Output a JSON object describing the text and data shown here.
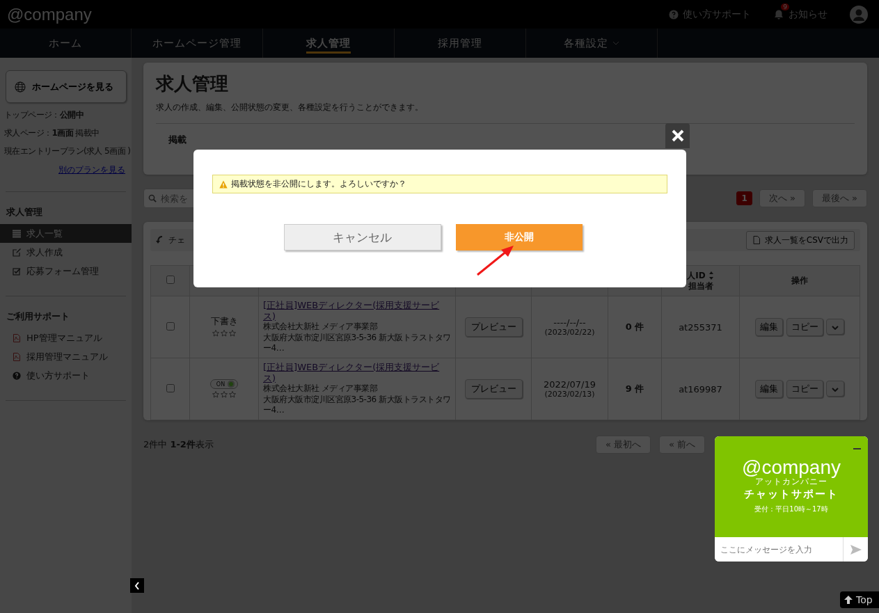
{
  "header": {
    "logo": "@company",
    "help": "使い方サポート",
    "notifications": {
      "label": "お知らせ",
      "badge": "9"
    }
  },
  "nav": [
    {
      "label": "ホーム",
      "selected": false,
      "dropdown": false
    },
    {
      "label": "ホームページ管理",
      "selected": false,
      "dropdown": false
    },
    {
      "label": "求人管理",
      "selected": true,
      "dropdown": false
    },
    {
      "label": "採用管理",
      "selected": false,
      "dropdown": false
    },
    {
      "label": "各種設定",
      "selected": false,
      "dropdown": true
    }
  ],
  "sidebar": {
    "view_site_button": "ホームページを見る",
    "status_lines": [
      "トップページ：**公開中**",
      "求人ページ：**1画面** 掲載中",
      "現在エントリープラン(求人 5画面 )"
    ],
    "plan_link": "別のプランを見る",
    "sections": [
      {
        "title": "求人管理",
        "items": [
          {
            "label": "求人一覧",
            "kind": "list",
            "selected": true
          },
          {
            "label": "求人作成",
            "kind": "edit",
            "selected": false
          },
          {
            "label": "応募フォーム管理",
            "kind": "check",
            "selected": false
          }
        ]
      },
      {
        "title": "ご利用サポート",
        "items": [
          {
            "label": "HP管理マニュアル",
            "kind": "pdf",
            "selected": false
          },
          {
            "label": "採用管理マニュアル",
            "kind": "pdf",
            "selected": false
          },
          {
            "label": "使い方サポート",
            "kind": "help",
            "selected": false
          }
        ]
      }
    ]
  },
  "page": {
    "title": "求人管理",
    "description": "求人の作成、編集、公開状態の変更、各種設定を行うことができます。",
    "status_label": "掲載"
  },
  "search": {
    "placeholder": "検索を"
  },
  "pagination_top": {
    "pages": [
      {
        "label": "1",
        "selected": true
      }
    ],
    "next": "次へ »",
    "last": "最後へ »"
  },
  "toolbar": {
    "check_label": "チェ",
    "csv_button": "求人一覧をCSVで出力"
  },
  "table": {
    "columns": {
      "id": "人ID",
      "id_sub": "担当者",
      "actions": "操作"
    },
    "header_checked": false,
    "rows": [
      {
        "checked": false,
        "status": {
          "kind": "text",
          "label": "下書き"
        },
        "stars": 0,
        "title": "[正社員]WEBディレクター(採用支援サービス)",
        "company": "株式会社大新社 メディア事業部",
        "address": "大阪府大阪市淀川区宮原3-5-36 新大阪トラストタワー4…",
        "preview": "プレビュー",
        "date": "----/--/--",
        "date_sub": "(2023/02/22)",
        "count": "0 件",
        "job_id": "at255371",
        "edit": "編集",
        "copy": "コピー"
      },
      {
        "checked": false,
        "status": {
          "kind": "toggle",
          "label": "ON",
          "on": true
        },
        "stars": 0,
        "title": "[正社員]WEBディレクター(採用支援サービス)",
        "company": "株式会社大新社 メディア事業部",
        "address": "大阪府大阪市淀川区宮原3-5-36 新大阪トラストタワー4…",
        "preview": "プレビュー",
        "date": "2022/07/19",
        "date_sub": "(2023/02/13)",
        "count": "9 件",
        "job_id": "at169987",
        "edit": "編集",
        "copy": "コピー"
      }
    ]
  },
  "summary": "2件中 **1-2件**表示",
  "pagination_bottom": {
    "first": "« 最初へ",
    "prev": "« 前へ"
  },
  "modal": {
    "message": "掲載状態を非公開にします。よろしいですか？",
    "cancel": "キャンセル",
    "confirm": "非公開"
  },
  "chat": {
    "logo": "@company",
    "logo_kana": "アットカンパニー",
    "title": "チャットサポート",
    "hours": "受付：平日10時～17時",
    "placeholder": "ここにメッセージを入力"
  },
  "top_button": "Top"
}
